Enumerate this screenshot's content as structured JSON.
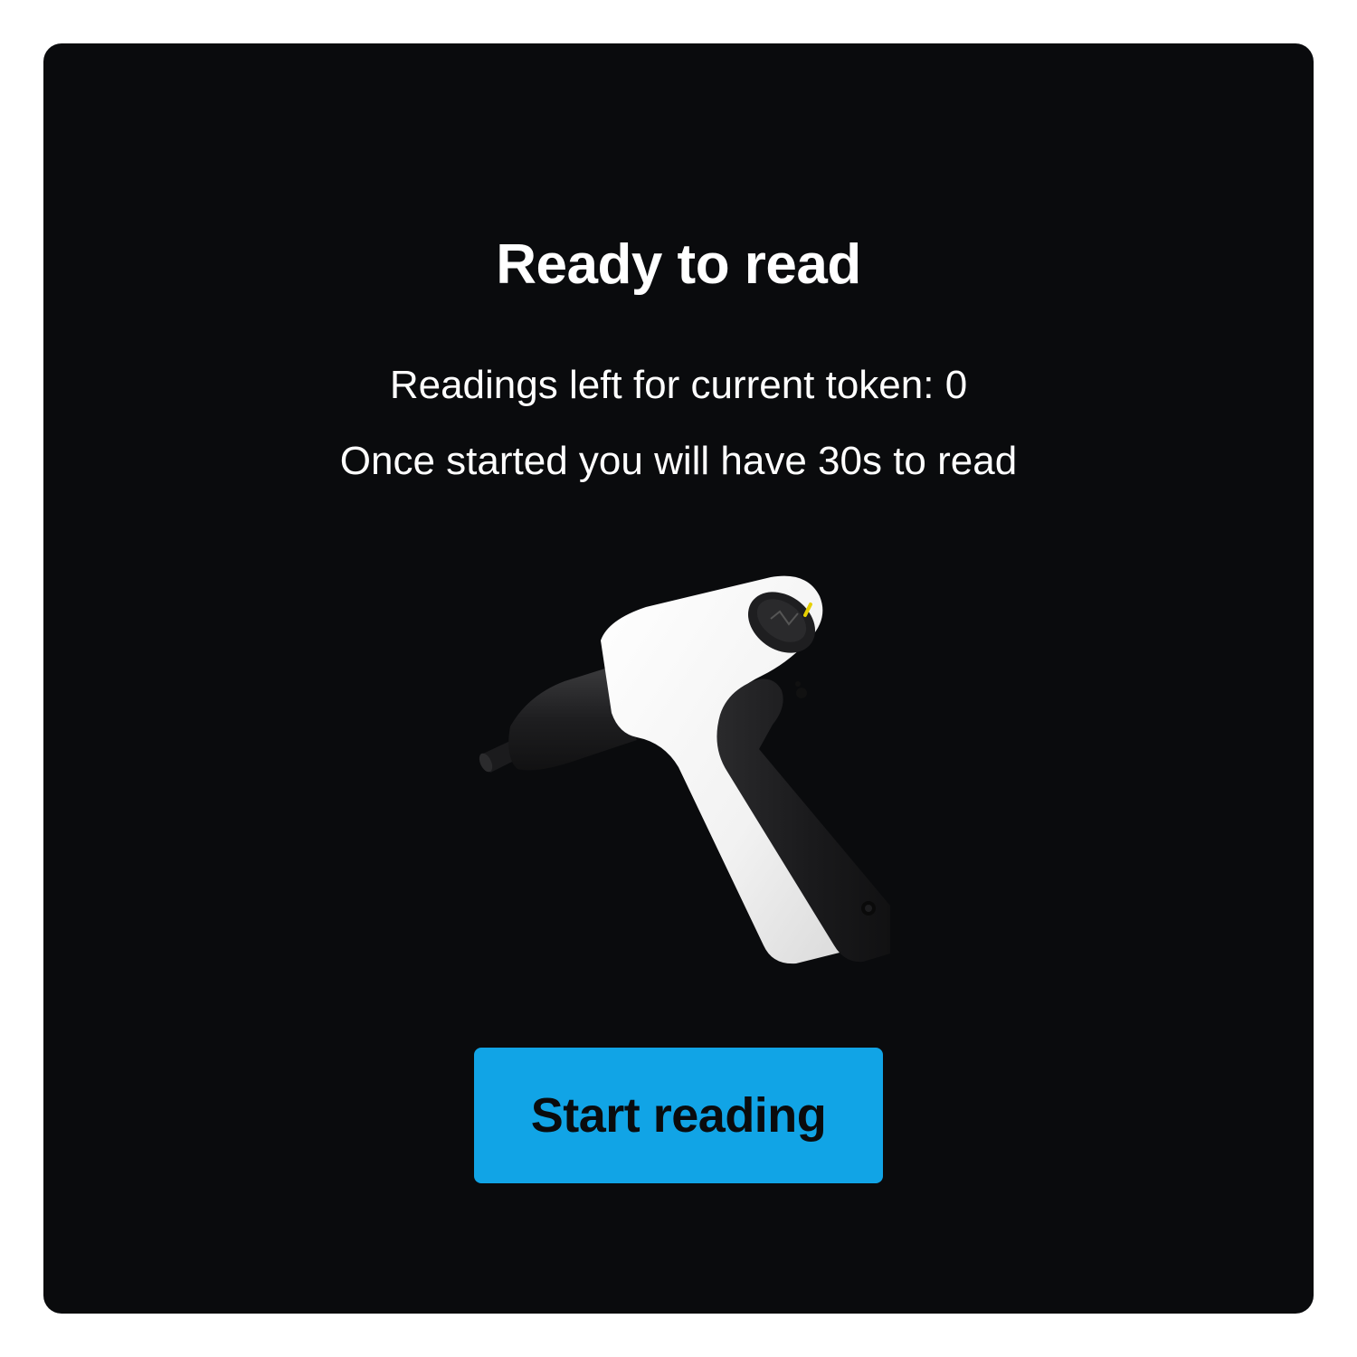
{
  "card": {
    "title": "Ready to read",
    "readings_left_text": "Readings left for current token: 0",
    "time_limit_text": "Once started you will have 30s to read"
  },
  "device_image": {
    "icon": "handheld-reader-device",
    "colors": {
      "body": "#f4f4f4",
      "grip": "#1c1c1e",
      "indicator": "#e6d000"
    }
  },
  "actions": {
    "start_label": "Start reading"
  },
  "colors": {
    "card_background": "#0a0b0d",
    "page_background": "#ffffff",
    "button_background": "#11a4e6",
    "text_primary": "#ffffff"
  }
}
